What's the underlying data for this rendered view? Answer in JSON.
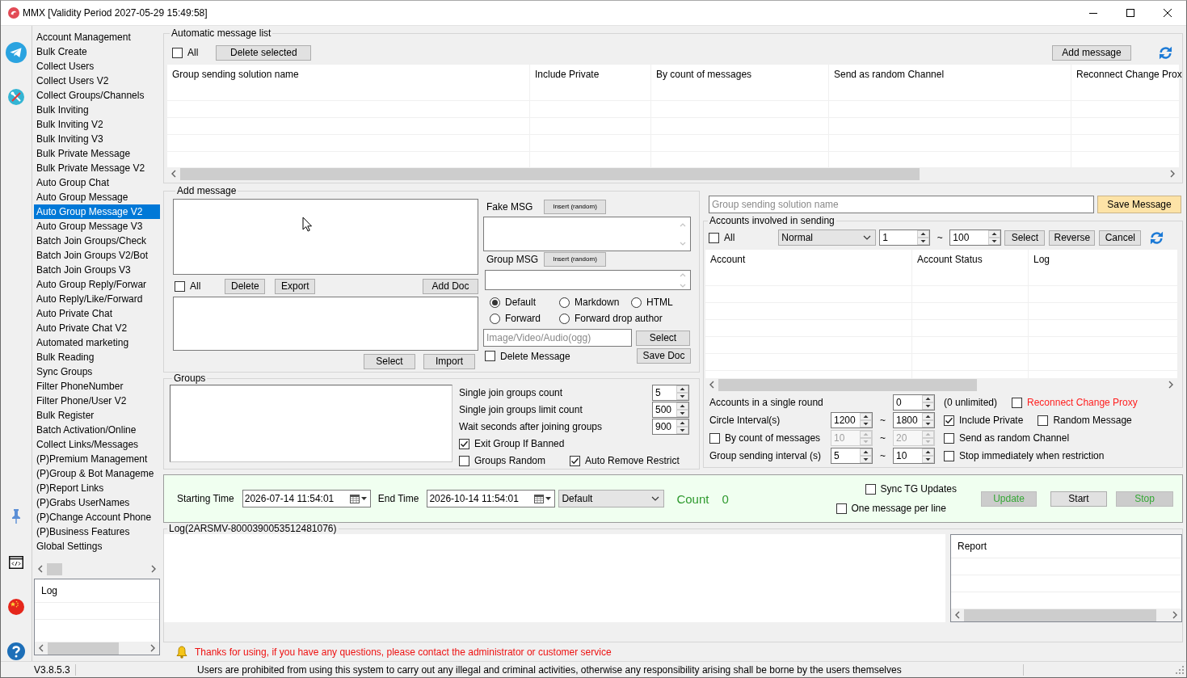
{
  "window": {
    "title": "MMX [Validity Period 2027-05-29 15:49:58]"
  },
  "sidebar": {
    "items": [
      {
        "label": "Account Management",
        "selected": false
      },
      {
        "label": "Bulk Create",
        "selected": false
      },
      {
        "label": "Collect Users",
        "selected": false
      },
      {
        "label": "Collect Users V2",
        "selected": false
      },
      {
        "label": "Collect Groups/Channels",
        "selected": false
      },
      {
        "label": "Bulk Inviting",
        "selected": false
      },
      {
        "label": "Bulk Inviting V2",
        "selected": false
      },
      {
        "label": "Bulk Inviting V3",
        "selected": false
      },
      {
        "label": "Bulk Private Message",
        "selected": false
      },
      {
        "label": "Bulk Private Message V2",
        "selected": false
      },
      {
        "label": "Auto Group Chat",
        "selected": false
      },
      {
        "label": "Auto Group Message",
        "selected": false
      },
      {
        "label": "Auto Group Message V2",
        "selected": true
      },
      {
        "label": "Auto Group Message V3",
        "selected": false
      },
      {
        "label": "Batch Join Groups/Check",
        "selected": false
      },
      {
        "label": "Batch Join Groups V2/Bot",
        "selected": false
      },
      {
        "label": "Batch Join Groups V3",
        "selected": false
      },
      {
        "label": "Auto Group Reply/Forwar",
        "selected": false
      },
      {
        "label": "Auto Reply/Like/Forward",
        "selected": false
      },
      {
        "label": "Auto Private Chat",
        "selected": false
      },
      {
        "label": "Auto Private Chat V2",
        "selected": false
      },
      {
        "label": "Automated marketing",
        "selected": false
      },
      {
        "label": "Bulk Reading",
        "selected": false
      },
      {
        "label": "Sync Groups",
        "selected": false
      },
      {
        "label": "Filter PhoneNumber",
        "selected": false
      },
      {
        "label": "Filter Phone/User V2",
        "selected": false
      },
      {
        "label": "Bulk Register",
        "selected": false
      },
      {
        "label": "Batch Activation/Online",
        "selected": false
      },
      {
        "label": "Collect Links/Messages",
        "selected": false
      },
      {
        "label": "(P)Premium Management",
        "selected": false
      },
      {
        "label": "(P)Group & Bot Manageme",
        "selected": false
      },
      {
        "label": "(P)Report Links",
        "selected": false
      },
      {
        "label": "(P)Grabs UserNames",
        "selected": false
      },
      {
        "label": "(P)Change Account Phone",
        "selected": false
      },
      {
        "label": "(P)Business Features",
        "selected": false
      },
      {
        "label": "Global Settings",
        "selected": false
      }
    ],
    "log_column": "Log"
  },
  "message_list": {
    "title": "Automatic message list",
    "select_all": {
      "label": "All",
      "checked": false
    },
    "delete_button": "Delete selected",
    "add_button": "Add message",
    "columns": [
      "Group sending solution name",
      "Include Private",
      "By count of messages",
      "Send as random Channel",
      "Reconnect Change Prox"
    ]
  },
  "add_message": {
    "title": "Add message",
    "select_all": {
      "label": "All",
      "checked": false
    },
    "delete_button": "Delete",
    "export_button": "Export",
    "add_doc_button": "Add Doc",
    "select_button": "Select",
    "import_button": "Import",
    "fake_msg": {
      "label": "Fake MSG",
      "insert_button": "Insert (random)"
    },
    "group_msg": {
      "label": "Group MSG",
      "insert_button": "Insert (random)"
    },
    "formats": [
      {
        "label": "Default",
        "selected": true
      },
      {
        "label": "Markdown",
        "selected": false
      },
      {
        "label": "HTML",
        "selected": false
      },
      {
        "label": "Forward",
        "selected": false
      },
      {
        "label": "Forward drop author",
        "selected": false
      }
    ],
    "media": {
      "placeholder": "Image/Video/Audio(ogg)",
      "select_button": "Select"
    },
    "delete_message": {
      "label": "Delete Message",
      "checked": false
    },
    "save_doc_button": "Save Doc"
  },
  "groups": {
    "title": "Groups",
    "settings": [
      {
        "label": "Single join groups count",
        "value": "5"
      },
      {
        "label": "Single join groups limit count",
        "value": "500"
      },
      {
        "label": "Wait seconds after joining groups",
        "value": "900"
      }
    ],
    "options": [
      {
        "label": "Exit Group If Banned",
        "checked": true
      },
      {
        "label": "Groups Random",
        "checked": false
      },
      {
        "label": "Auto Remove Restrict",
        "checked": true
      }
    ]
  },
  "sending": {
    "name_field": {
      "placeholder": "Group sending solution name"
    },
    "save_button": "Save Message",
    "title": "Accounts involved in sending",
    "select_all": {
      "label": "All",
      "checked": false
    },
    "mode": "Normal",
    "range_from": "1",
    "range_separator": "~",
    "range_to": "100",
    "buttons": [
      "Select",
      "Reverse",
      "Cancel"
    ],
    "columns": [
      "Account",
      "Account Status",
      "Log"
    ],
    "accounts_per_round": {
      "label": "Accounts in a single round",
      "value": "0",
      "note": "(0 unlimited)"
    },
    "circle_interval": {
      "label": "Circle Interval(s)",
      "from": "1200",
      "separator": "~",
      "to": "1800"
    },
    "by_count": {
      "label": "By count of messages",
      "checked": false,
      "from": "10",
      "separator": "~",
      "to": "20",
      "disabled": true
    },
    "group_interval": {
      "label": "Group sending interval (s)",
      "from": "5",
      "separator": "~",
      "to": "10"
    },
    "options": [
      {
        "label": "Reconnect Change Proxy",
        "checked": false,
        "alert": true
      },
      {
        "label": "Include Private",
        "checked": true,
        "alert": false
      },
      {
        "label": "Random Message",
        "checked": false,
        "alert": false
      },
      {
        "label": "Send as random Channel",
        "checked": false,
        "alert": false
      },
      {
        "label": "Stop immediately when restriction",
        "checked": false,
        "alert": false
      }
    ]
  },
  "schedule": {
    "start": {
      "label": "Starting Time",
      "value": "2026-07-14 11:54:01"
    },
    "end": {
      "label": "End Time",
      "value": "2026-10-14 11:54:01"
    },
    "mode": "Default",
    "count": {
      "label": "Count",
      "value": "0"
    },
    "options": [
      {
        "label": "Sync TG Updates",
        "checked": false
      },
      {
        "label": "One message per line",
        "checked": false
      }
    ],
    "buttons": [
      {
        "label": "Update",
        "disabled": true
      },
      {
        "label": "Start",
        "disabled": false
      },
      {
        "label": "Stop",
        "disabled": true
      }
    ]
  },
  "log": {
    "title": "Log(2ARSMV-8000390053512481076)",
    "report_column": "Report"
  },
  "notice": "Thanks for using, if you have any questions, please contact the administrator or customer service",
  "status_bar": {
    "version": "V3.8.5.3",
    "message": "Users are prohibited from using this system to carry out any illegal and criminal activities, otherwise any responsibility arising shall be borne by the users themselves"
  }
}
